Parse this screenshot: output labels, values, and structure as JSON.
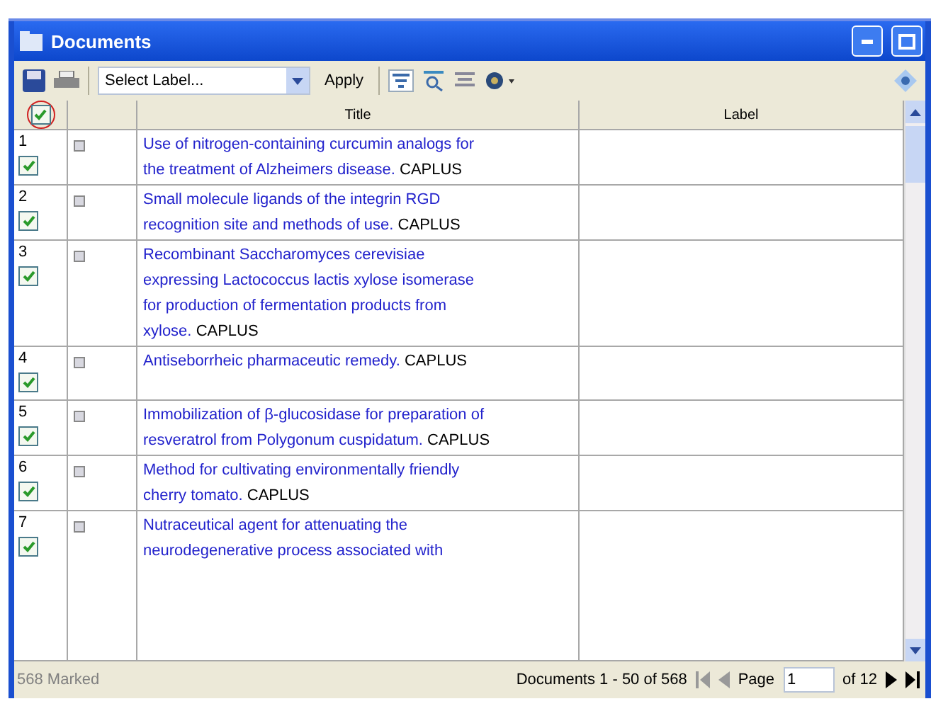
{
  "window": {
    "title": "Documents"
  },
  "toolbar": {
    "label_select": {
      "placeholder": "Select Label..."
    },
    "apply": "Apply"
  },
  "table": {
    "header_checked": true,
    "columns": [
      "Title",
      "Label"
    ],
    "rows": [
      {
        "number": "1",
        "checked": true,
        "title": "Use of nitrogen-containing curcumin analogs for the treatment of Alzheimers disease.",
        "source": "CAPLUS"
      },
      {
        "number": "2",
        "checked": true,
        "title": "Small molecule ligands of the integrin RGD recognition site and methods of use.",
        "source": "CAPLUS"
      },
      {
        "number": "3",
        "checked": true,
        "title": "Recombinant Saccharomyces cerevisiae expressing Lactococcus lactis xylose isomerase for production of fermentation products from xylose.",
        "source": "CAPLUS"
      },
      {
        "number": "4",
        "checked": true,
        "title": "Antiseborrheic pharmaceutic remedy.",
        "source": "CAPLUS"
      },
      {
        "number": "5",
        "checked": true,
        "title": "Immobilization of β-glucosidase for preparation of resveratrol from Polygonum cuspidatum.",
        "source": "CAPLUS"
      },
      {
        "number": "6",
        "checked": true,
        "title": "Method for cultivating environmentally friendly cherry tomato.",
        "source": "CAPLUS"
      },
      {
        "number": "7",
        "checked": true,
        "title": "Nutraceutical agent for attenuating the neurodegenerative process associated with"
      }
    ]
  },
  "status_bar": {
    "marked": "568 Marked",
    "range": "Documents 1 - 50 of 568",
    "page_label": "Page",
    "page_value": "1",
    "page_total": "of 12"
  }
}
